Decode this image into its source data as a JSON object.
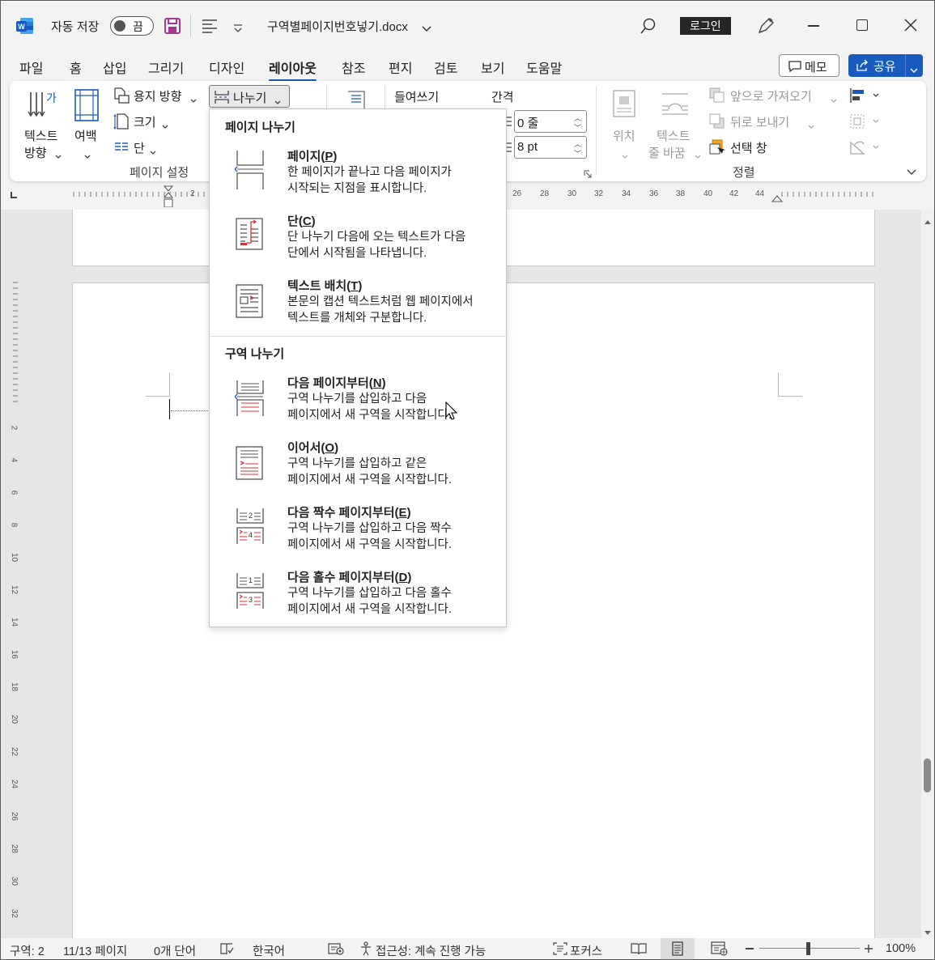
{
  "titlebar": {
    "autosave_label": "자동 저장",
    "autosave_state": "끔",
    "filename": "구역별페이지번호넣기.docx",
    "login": "로그인"
  },
  "tabs": [
    "파일",
    "홈",
    "삽입",
    "그리기",
    "디자인",
    "레이아웃",
    "참조",
    "편지",
    "검토",
    "보기",
    "도움말"
  ],
  "active_tab": "레이아웃",
  "memo": "메모",
  "share": "공유",
  "ribbon": {
    "text_direction": [
      "텍스트",
      "방향"
    ],
    "margins": "여백",
    "orientation": "용지 방향",
    "size": "크기",
    "columns": "단",
    "breaks": "나누기",
    "group_page_setup": "페이지 설정",
    "indent_label": "들여쓰기",
    "spacing_label": "간격",
    "spacing_before": "0 줄",
    "spacing_after": "8 pt",
    "position": "위치",
    "wrap_text": [
      "텍스트",
      "줄 바꿈"
    ],
    "bring_forward": "앞으로 가져오기",
    "send_backward": "뒤로 보내기",
    "selection_pane": "선택 창",
    "group_arrange": "정렬"
  },
  "ruler": {
    "h_labels": [
      "2",
      "26",
      "28",
      "30",
      "32",
      "34",
      "36",
      "38",
      "40",
      "42",
      "44"
    ],
    "v_labels": [
      "2",
      "4",
      "6",
      "8",
      "10",
      "12",
      "14",
      "16",
      "18",
      "20",
      "22",
      "24",
      "26",
      "28",
      "30",
      "32"
    ]
  },
  "dropdown": {
    "section1": "페이지 나누기",
    "section2": "구역 나누기",
    "items": [
      {
        "title": "페이지",
        "key": "P",
        "desc": "한 페이지가 끝나고 다음 페이지가\n시작되는 지점을 표시합니다.",
        "icon": "page-break-icon"
      },
      {
        "title": "단",
        "key": "C",
        "desc": "단 나누기 다음에 오는 텍스트가 다음\n단에서 시작됨을 나타냅니다.",
        "icon": "column-break-icon"
      },
      {
        "title": "텍스트 배치",
        "key": "T",
        "desc": "본문의 캡션 텍스트처럼 웹 페이지에서\n텍스트를 개체와 구분합니다.",
        "icon": "text-wrapping-break-icon"
      },
      {
        "title": "다음 페이지부터",
        "key": "N",
        "desc": "구역 나누기를 삽입하고 다음\n페이지에서 새 구역을 시작합니다.",
        "icon": "next-page-section-icon"
      },
      {
        "title": "이어서",
        "key": "O",
        "desc": "구역 나누기를 삽입하고 같은\n페이지에서 새 구역을 시작합니다.",
        "icon": "continuous-section-icon"
      },
      {
        "title": "다음 짝수 페이지부터",
        "key": "E",
        "desc": "구역 나누기를 삽입하고 다음 짝수\n페이지에서 새 구역을 시작합니다.",
        "icon": "even-page-section-icon"
      },
      {
        "title": "다음 홀수 페이지부터",
        "key": "D",
        "desc": "구역 나누기를 삽입하고 다음 홀수\n페이지에서 새 구역을 시작합니다.",
        "icon": "odd-page-section-icon"
      }
    ]
  },
  "status": {
    "section": "구역: 2",
    "page": "11/13 페이지",
    "words": "0개 단어",
    "language": "한국어",
    "accessibility": "접근성: 계속 진행 가능",
    "focus": "포커스",
    "zoom": "100%"
  }
}
